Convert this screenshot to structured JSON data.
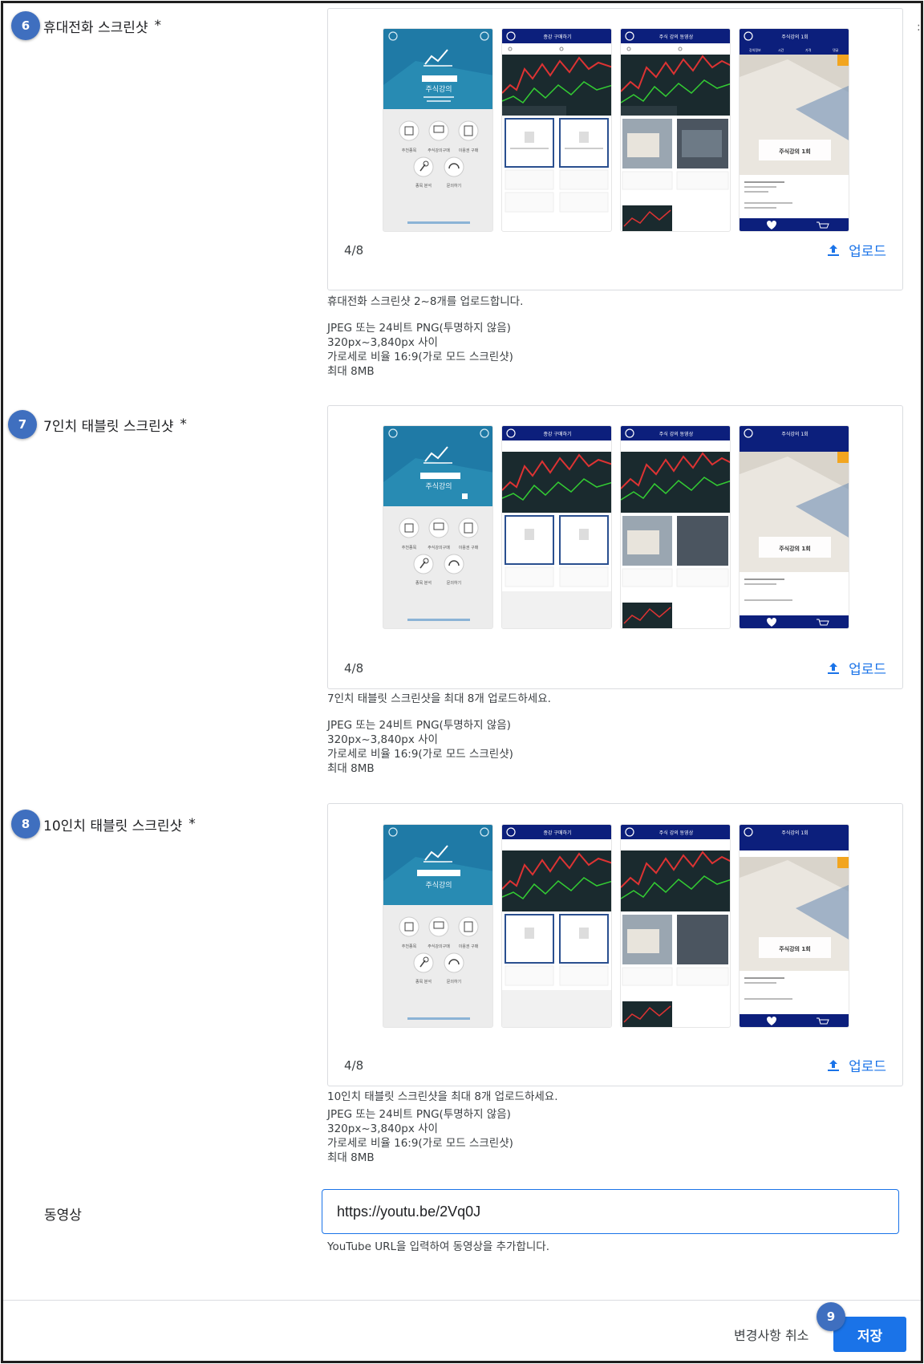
{
  "sections": [
    {
      "badge": "6",
      "label": "휴대전화 스크린샷",
      "required": "*",
      "counter": "4/8",
      "upload_label": "업로드",
      "hint_title": "휴대전화 스크린샷 2~8개를 업로드합니다.",
      "hint_lines": [
        "JPEG 또는 24비트 PNG(투명하지 않음)",
        "320px~3,840px 사이",
        "가로세로 비율 16:9(가로 모드 스크린샷)",
        "최대 8MB"
      ]
    },
    {
      "badge": "7",
      "label": "7인치 태블릿 스크린샷",
      "required": "*",
      "counter": "4/8",
      "upload_label": "업로드",
      "hint_title": "7인치 태블릿 스크린샷을 최대 8개 업로드하세요.",
      "hint_lines": [
        "JPEG 또는 24비트 PNG(투명하지 않음)",
        "320px~3,840px 사이",
        "가로세로 비율 16:9(가로 모드 스크린샷)",
        "최대 8MB"
      ]
    },
    {
      "badge": "8",
      "label": "10인치 태블릿 스크린샷",
      "required": "*",
      "counter": "4/8",
      "upload_label": "업로드",
      "hint_title": "10인치 태블릿 스크린샷을 최대 8개 업로드하세요.",
      "hint_lines": [
        "JPEG 또는 24비트 PNG(투명하지 않음)",
        "320px~3,840px 사이",
        "가로세로 비율 16:9(가로 모드 스크린샷)",
        "최대 8MB"
      ]
    }
  ],
  "screenshot_text": {
    "s1_title": "주식강의",
    "s1_menu": [
      "추천종목",
      "주식강의구매",
      "이용권 구매",
      "종목 분석",
      "문의하기"
    ],
    "s2_header": "종강 구매하기",
    "s3_header": "주식 강의 동영상",
    "s4_header": "주식강의 1회",
    "s4_card": "주식강의 1회",
    "s4_tabs": [
      "강의정보",
      "시간",
      "가격",
      "댓글"
    ]
  },
  "video": {
    "label": "동영상",
    "value": "https://youtu.be/2Vq0J",
    "hint": "YouTube URL을 입력하여 동영상을 추가합니다."
  },
  "footer": {
    "cancel_label": "변경사항 취소",
    "save_label": "저장",
    "badge": "9"
  },
  "colors": {
    "accent": "#1a73e8",
    "badge": "#3f6fbf",
    "app_navy": "#0c1f7c",
    "app_teal": "#1f7aa6"
  }
}
